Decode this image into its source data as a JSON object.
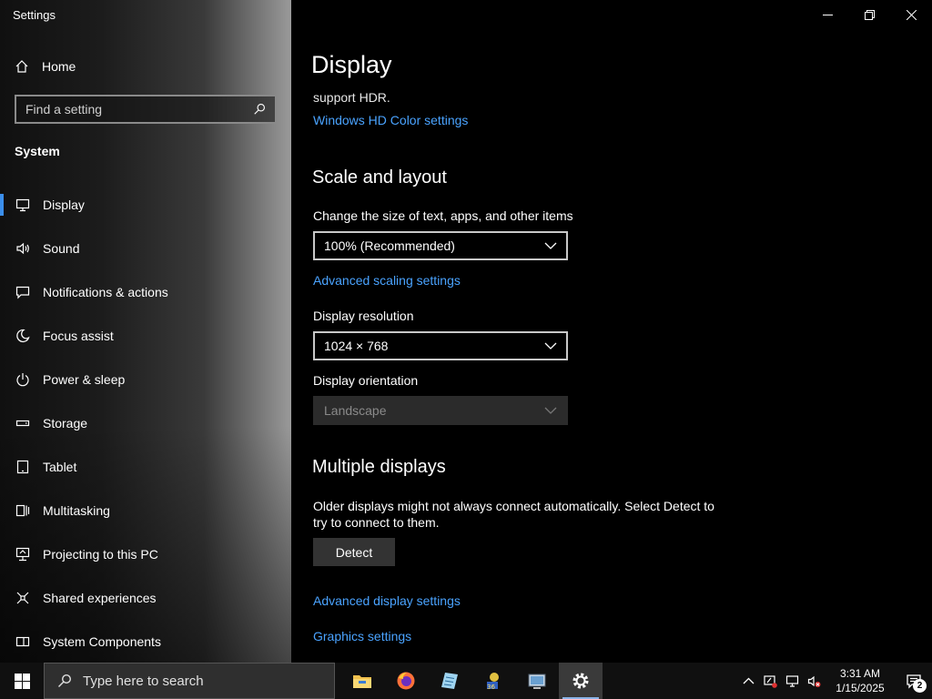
{
  "app": {
    "title": "Settings"
  },
  "sidebar": {
    "home_label": "Home",
    "search_placeholder": "Find a setting",
    "section": "System",
    "items": [
      {
        "label": "Display",
        "icon": "monitor-icon",
        "active": true
      },
      {
        "label": "Sound",
        "icon": "speaker-icon"
      },
      {
        "label": "Notifications & actions",
        "icon": "notification-icon"
      },
      {
        "label": "Focus assist",
        "icon": "moon-icon"
      },
      {
        "label": "Power & sleep",
        "icon": "power-icon"
      },
      {
        "label": "Storage",
        "icon": "storage-icon"
      },
      {
        "label": "Tablet",
        "icon": "tablet-icon"
      },
      {
        "label": "Multitasking",
        "icon": "multitasking-icon"
      },
      {
        "label": "Projecting to this PC",
        "icon": "projecting-icon"
      },
      {
        "label": "Shared experiences",
        "icon": "shared-experiences-icon"
      },
      {
        "label": "System Components",
        "icon": "system-components-icon"
      }
    ]
  },
  "main": {
    "title": "Display",
    "clipped_text": "support HDR.",
    "hdr_link": "Windows HD Color settings",
    "scale": {
      "heading": "Scale and layout",
      "size_label": "Change the size of text, apps, and other items",
      "size_value": "100% (Recommended)",
      "advanced_link": "Advanced scaling settings",
      "resolution_label": "Display resolution",
      "resolution_value": "1024 × 768",
      "orientation_label": "Display orientation",
      "orientation_value": "Landscape"
    },
    "multiple": {
      "heading": "Multiple displays",
      "description": "Older displays might not always connect automatically. Select Detect to try to connect to them.",
      "detect_label": "Detect",
      "advanced_display_link": "Advanced display settings",
      "graphics_link": "Graphics settings"
    }
  },
  "taskbar": {
    "search_placeholder": "Type here to search",
    "apps": [
      "file-explorer-icon",
      "firefox-icon",
      "notepad-icon",
      "game-icon",
      "control-panel-icon",
      "settings-gear-icon"
    ],
    "time": "3:31 AM",
    "date": "1/15/2025",
    "notification_count": "2"
  },
  "colors": {
    "accent": "#3b8eea",
    "link": "#4aa3ff"
  }
}
